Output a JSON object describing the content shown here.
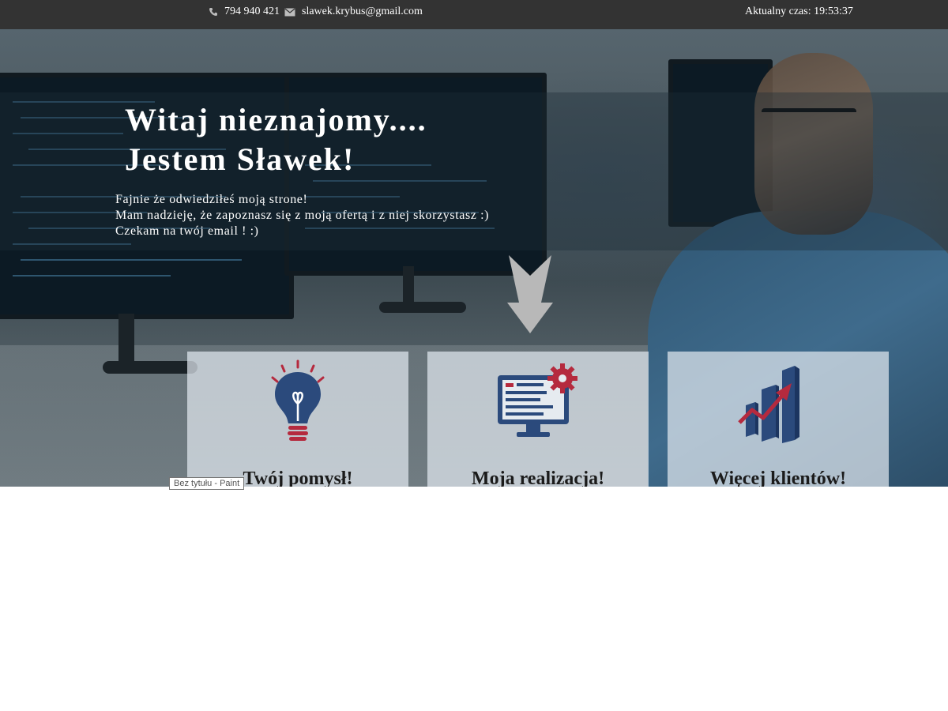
{
  "topbar": {
    "phone": "794 940 421",
    "email": "slawek.krybus@gmail.com",
    "clock_label": "Aktualny czas:",
    "clock_value": "19:53:37",
    "icons": [
      "phone-icon",
      "envelope-icon"
    ]
  },
  "hero": {
    "headline_line1": "Witaj nieznajomy....",
    "headline_line2": "Jestem Sławek!",
    "intro_lines": [
      "Fajnie że odwiedziłeś moją strone!",
      "Mam nadzieję, że zapoznasz się z moją ofertą i z niej skorzystasz :)",
      "Czekam na twój email ! :)"
    ]
  },
  "cards": [
    {
      "title": "Twój pomysł!",
      "icon": "lightbulb-icon"
    },
    {
      "title": "Moja realizacja!",
      "icon": "monitor-gear-icon"
    },
    {
      "title": "Więcej klientów!",
      "icon": "growth-chart-icon"
    }
  ],
  "tooltip": "Bez tytułu - Paint",
  "colors": {
    "topbar": "#333333",
    "icon_navy": "#2b4a7c",
    "icon_red": "#b52a3e",
    "arrow": "#b8b8b8"
  }
}
